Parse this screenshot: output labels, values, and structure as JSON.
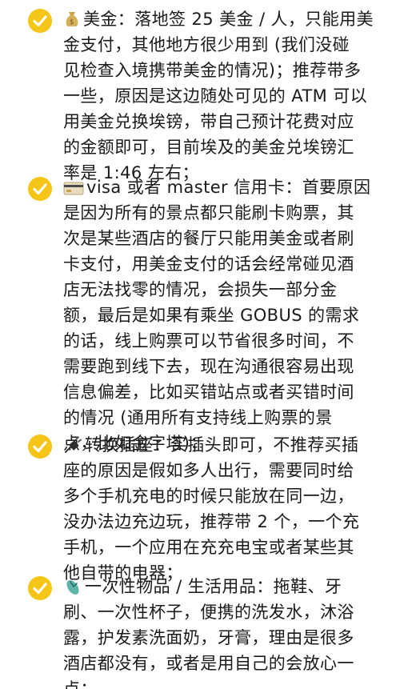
{
  "items": [
    {
      "icon": "money-bag-icon",
      "lines": [
        "美金：落地签 25 美金 / 人，只能用美",
        "金支付，其他地方很少用到 (我们没碰",
        "见检查入境携带美金的情况)；推荐带多",
        "一些，原因是这边随处可见的 ATM 可以",
        "用美金兑换埃镑，带自己预计花费对应",
        "的金额即可，目前埃及的美金兑埃镑汇",
        "率是 1:46 左右；"
      ]
    },
    {
      "icon": "credit-card-icon",
      "lines": [
        "visa 或者 master 信用卡：首要原因",
        "是因为所有的景点都只能刷卡购票，其",
        "次是某些酒店的餐厅只能用美金或者刷",
        "卡支付，用美金支付的话会经常碰见酒",
        "店无法找零的情况，会损失一部分金",
        "额，最后是如果有乘坐 GOBUS 的需求",
        "的话，线上购票可以节省很多时间，不",
        "需要跑到线下去，现在沟通很容易出现",
        "信息偏差，比如买错站点或者买错时间",
        "的情况 (通用所有支持线上购票的景",
        "点，比如金字塔)；"
      ]
    },
    {
      "icon": "plug-icon",
      "lines": [
        "转换插座：买插头即可，不推荐买插",
        "座的原因是假如多人出行，需要同时给",
        "多个手机充电的时候只能放在同一边，",
        "没办法边充边玩，推荐带 2 个，一个充",
        "手机，一个应用在充充电宝或者某些其",
        "他自带的电器；"
      ]
    },
    {
      "icon": "flip-flop-icon",
      "lines": [
        "一次性物品 / 生活用品：拖鞋、牙",
        "刷、一次性杯子，便携的洗发水，沐浴",
        "露，护发素洗面奶，牙膏，理由是很多",
        "酒店都没有，或者是用自己的会放心一",
        "点；"
      ]
    }
  ]
}
